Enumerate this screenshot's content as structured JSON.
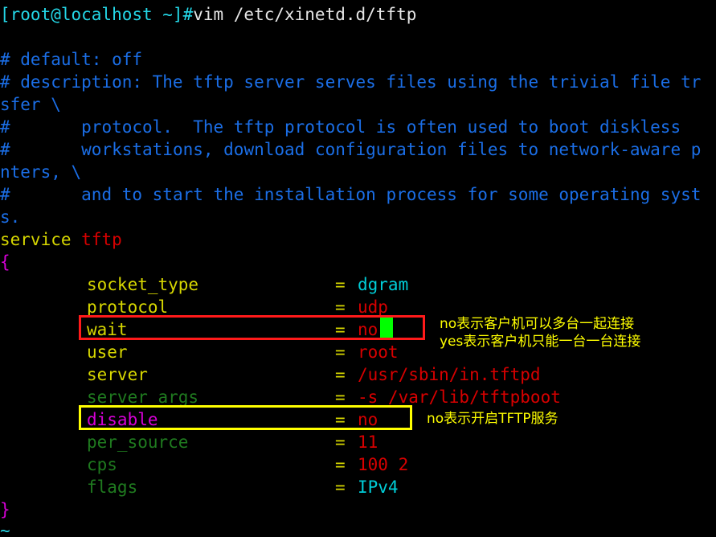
{
  "terminal": {
    "background": "#000000",
    "shell_prompt": {
      "prompt": "[root@localhost ~]#",
      "command": "vim /etc/xinetd.d/tftp"
    },
    "editor": "vim",
    "file_path": "/etc/xinetd.d/tftp"
  },
  "file_lines": [
    {
      "id": "l1",
      "text": "# default: off"
    },
    {
      "id": "l2",
      "text": "# description: The tftp server serves files using the trivial file tr"
    },
    {
      "id": "l3",
      "text": "sfer \\"
    },
    {
      "id": "l4",
      "text": "#\tprotocol.  The tftp protocol is often used to boot diskless "
    },
    {
      "id": "l5",
      "text": "#\tworkstations, download configuration files to network-aware p"
    },
    {
      "id": "l6",
      "text": "nters, \\"
    },
    {
      "id": "l7",
      "text": "#\tand to start the installation process for some operating syst"
    },
    {
      "id": "l8",
      "text": "s."
    }
  ],
  "service_block": {
    "keyword": "service",
    "name": "tftp",
    "open_brace": "{",
    "close_brace": "}",
    "entries": [
      {
        "key": "socket_type",
        "eq": "=",
        "value": "dgram",
        "key_color": "yellow",
        "value_color": "cyan"
      },
      {
        "key": "protocol",
        "eq": "=",
        "value": "udp",
        "key_color": "yellow",
        "value_color": "red"
      },
      {
        "key": "wait",
        "eq": "=",
        "value": "no",
        "key_color": "yellow",
        "value_color": "red"
      },
      {
        "key": "user",
        "eq": "=",
        "value": "root",
        "key_color": "yellow",
        "value_color": "red"
      },
      {
        "key": "server",
        "eq": "=",
        "value": "/usr/sbin/in.tftpd",
        "key_color": "yellow",
        "value_color": "red"
      },
      {
        "key": "server_args",
        "eq": "=",
        "value": "-s /var/lib/tftpboot",
        "key_color": "green",
        "value_color": "red"
      },
      {
        "key": "disable",
        "eq": "=",
        "value": "no",
        "key_color": "magenta",
        "value_color": "red"
      },
      {
        "key": "per_source",
        "eq": "=",
        "value": "11",
        "key_color": "green",
        "value_color": "red"
      },
      {
        "key": "cps",
        "eq": "=",
        "value": "100 2",
        "key_color": "green",
        "value_color": "red"
      },
      {
        "key": "flags",
        "eq": "=",
        "value": "IPv4",
        "key_color": "green",
        "value_color": "cyan"
      }
    ]
  },
  "empty_line_marker": "~",
  "annotations": [
    {
      "id": "a1",
      "text": "no表示客户机可以多台一起连接",
      "color": "#ffff00"
    },
    {
      "id": "a2",
      "text": "yes表示客户机只能一台一台连接",
      "color": "#ffff00"
    },
    {
      "id": "a3",
      "text": "no表示开启TFTP服务",
      "color": "#ffff00"
    }
  ],
  "highlights": [
    {
      "id": "wait_box",
      "target": "wait",
      "color": "#ff1a1a"
    },
    {
      "id": "disable_box",
      "target": "disable",
      "color": "#ffff00"
    }
  ],
  "cursor": {
    "color": "#00ff00",
    "on_line": "wait",
    "after_text": "no"
  },
  "colors": {
    "comment": "#1b6ee6",
    "keyword": "#d7d700",
    "string": "#d70000",
    "special": "#00cdd7",
    "brace": "#d700d7",
    "dim": "#1f7a1f",
    "prompt": "#24d7e7",
    "command": "#e6e6e6"
  }
}
